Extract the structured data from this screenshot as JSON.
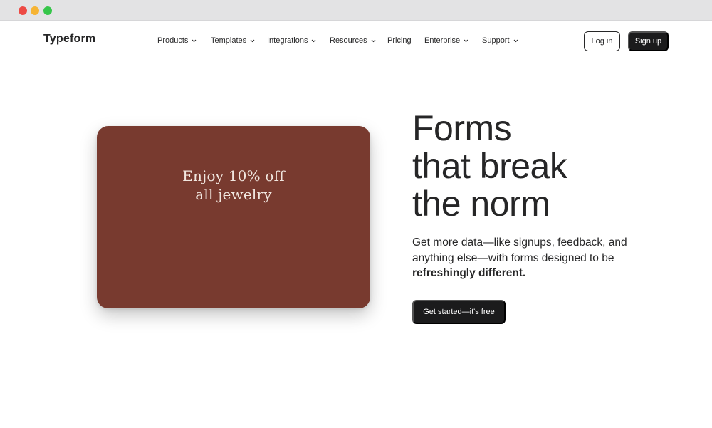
{
  "nav": {
    "logo": "Typeform",
    "menu": [
      {
        "label": "Products",
        "has_dropdown": true
      },
      {
        "label": "Templates",
        "has_dropdown": true
      },
      {
        "label": "Integrations",
        "has_dropdown": true
      },
      {
        "label": "Resources",
        "has_dropdown": true
      },
      {
        "label": "Pricing",
        "has_dropdown": false
      },
      {
        "label": "Enterprise",
        "has_dropdown": true
      },
      {
        "label": "Support",
        "has_dropdown": true
      }
    ],
    "login_label": "Log in",
    "signup_label": "Sign up"
  },
  "promo_card": {
    "line1": "Enjoy 10% off",
    "line2": "all jewelry",
    "background_color": "#783a2f"
  },
  "hero": {
    "title_lines": [
      "Forms",
      "that break",
      "the norm"
    ],
    "subtitle_part1": "Get more data—like signups, feedback, and anything else—with forms designed to be ",
    "subtitle_bold": "refreshingly different.",
    "cta_label": "Get started—it's free"
  },
  "colors": {
    "text": "#262627",
    "button_dark": "#1b1b1c",
    "titlebar": "#e3e3e4",
    "traffic_red": "#ed4a44",
    "traffic_yellow": "#f6b434",
    "traffic_green": "#36c64a"
  },
  "icons": {
    "dropdown": "chevron-down-icon"
  }
}
